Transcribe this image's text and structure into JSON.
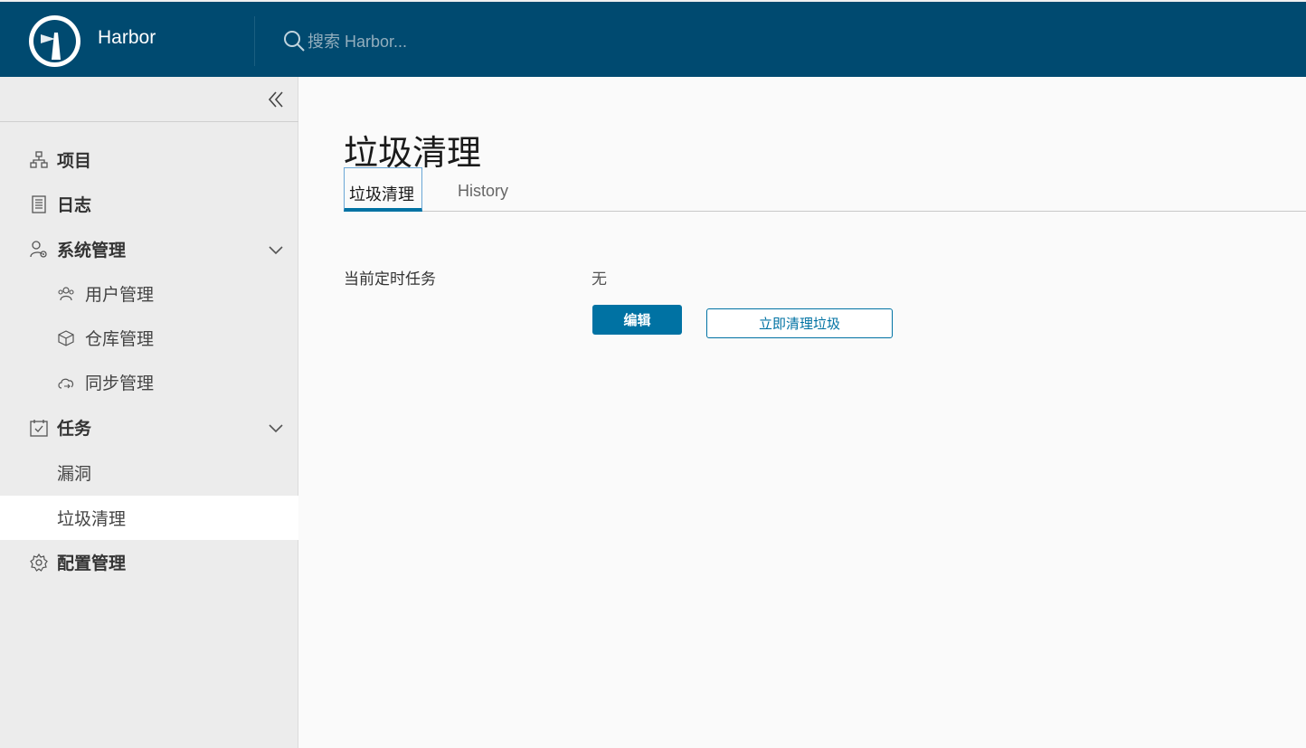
{
  "header": {
    "brand": "Harbor",
    "search_placeholder": "搜索 Harbor...",
    "bg_color": "#004a70"
  },
  "sidebar": {
    "items": [
      {
        "label": "项目",
        "icon": "project-icon"
      },
      {
        "label": "日志",
        "icon": "logs-icon"
      },
      {
        "label": "系统管理",
        "icon": "admin-icon",
        "expanded": true,
        "children": [
          {
            "label": "用户管理",
            "icon": "users-icon"
          },
          {
            "label": "仓库管理",
            "icon": "registry-icon"
          },
          {
            "label": "同步管理",
            "icon": "replication-icon"
          }
        ]
      },
      {
        "label": "任务",
        "icon": "tasks-icon",
        "expanded": true,
        "children": [
          {
            "label": "漏洞"
          },
          {
            "label": "垃圾清理",
            "active": true
          }
        ]
      },
      {
        "label": "配置管理",
        "icon": "gear-icon"
      }
    ]
  },
  "main": {
    "title": "垃圾清理",
    "tabs": [
      {
        "label": "垃圾清理",
        "active": true
      },
      {
        "label": "History",
        "active": false
      }
    ],
    "schedule_label": "当前定时任务",
    "schedule_value": "无",
    "edit_button": "编辑",
    "gc_now_button": "立即清理垃圾",
    "accent_color": "#0072a3"
  }
}
